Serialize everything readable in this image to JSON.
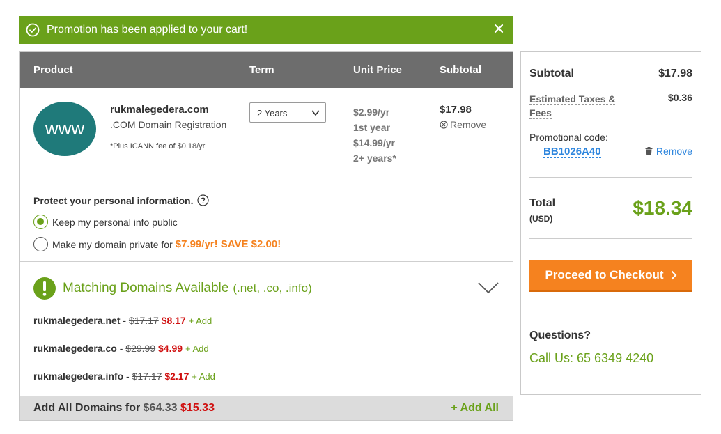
{
  "banner": {
    "message": "Promotion has been applied to your cart!"
  },
  "cart": {
    "headers": {
      "product": "Product",
      "term": "Term",
      "unit_price": "Unit Price",
      "subtotal": "Subtotal"
    },
    "item": {
      "logo_text": "www",
      "domain": "rukmalegedera.com",
      "description": ".COM Domain Registration",
      "fee_note": "*Plus ICANN fee of $0.18/yr",
      "term": "2 Years",
      "price_first": "$2.99/yr",
      "price_first_label": "1st year",
      "price_renew": "$14.99/yr",
      "price_renew_label": "2+ years*",
      "subtotal": "$17.98",
      "remove": "Remove"
    },
    "privacy": {
      "title": "Protect your personal information.",
      "option_public": "Keep my personal info public",
      "option_private": "Make my domain private for",
      "private_offer": "$7.99/yr! SAVE $2.00!",
      "selected": "public"
    },
    "matching": {
      "title": "Matching Domains Available",
      "tlds": "(.net, .co, .info)",
      "domains": [
        {
          "name": "rukmalegedera.net",
          "sep": " - ",
          "old_price": "$17.17",
          "new_price": "$8.17",
          "add": "+ Add"
        },
        {
          "name": "rukmalegedera.co",
          "sep": " - ",
          "old_price": "$29.99",
          "new_price": "$4.99",
          "add": "+ Add"
        },
        {
          "name": "rukmalegedera.info",
          "sep": " - ",
          "old_price": "$17.17",
          "new_price": "$2.17",
          "add": "+ Add"
        }
      ],
      "add_all_label": "Add All Domains for",
      "add_all_old": "$64.33",
      "add_all_new": "$15.33",
      "add_all_button": "+ Add All"
    }
  },
  "summary": {
    "subtotal_label": "Subtotal",
    "subtotal": "$17.98",
    "taxes_label": "Estimated Taxes & Fees",
    "taxes": "$0.36",
    "promo_label": "Promotional code:",
    "promo_code": "BB1026A40",
    "promo_remove": "Remove",
    "total_label": "Total",
    "currency": "(USD)",
    "total": "$18.34",
    "checkout": "Proceed to Checkout",
    "questions": "Questions?",
    "call": "Call Us: 65 6349 4240"
  },
  "colors": {
    "brand_green": "#6aa11a",
    "orange": "#f5821f",
    "header_gray": "#6d6d6d",
    "teal": "#1f7a7a",
    "link_blue": "#2e86de"
  }
}
